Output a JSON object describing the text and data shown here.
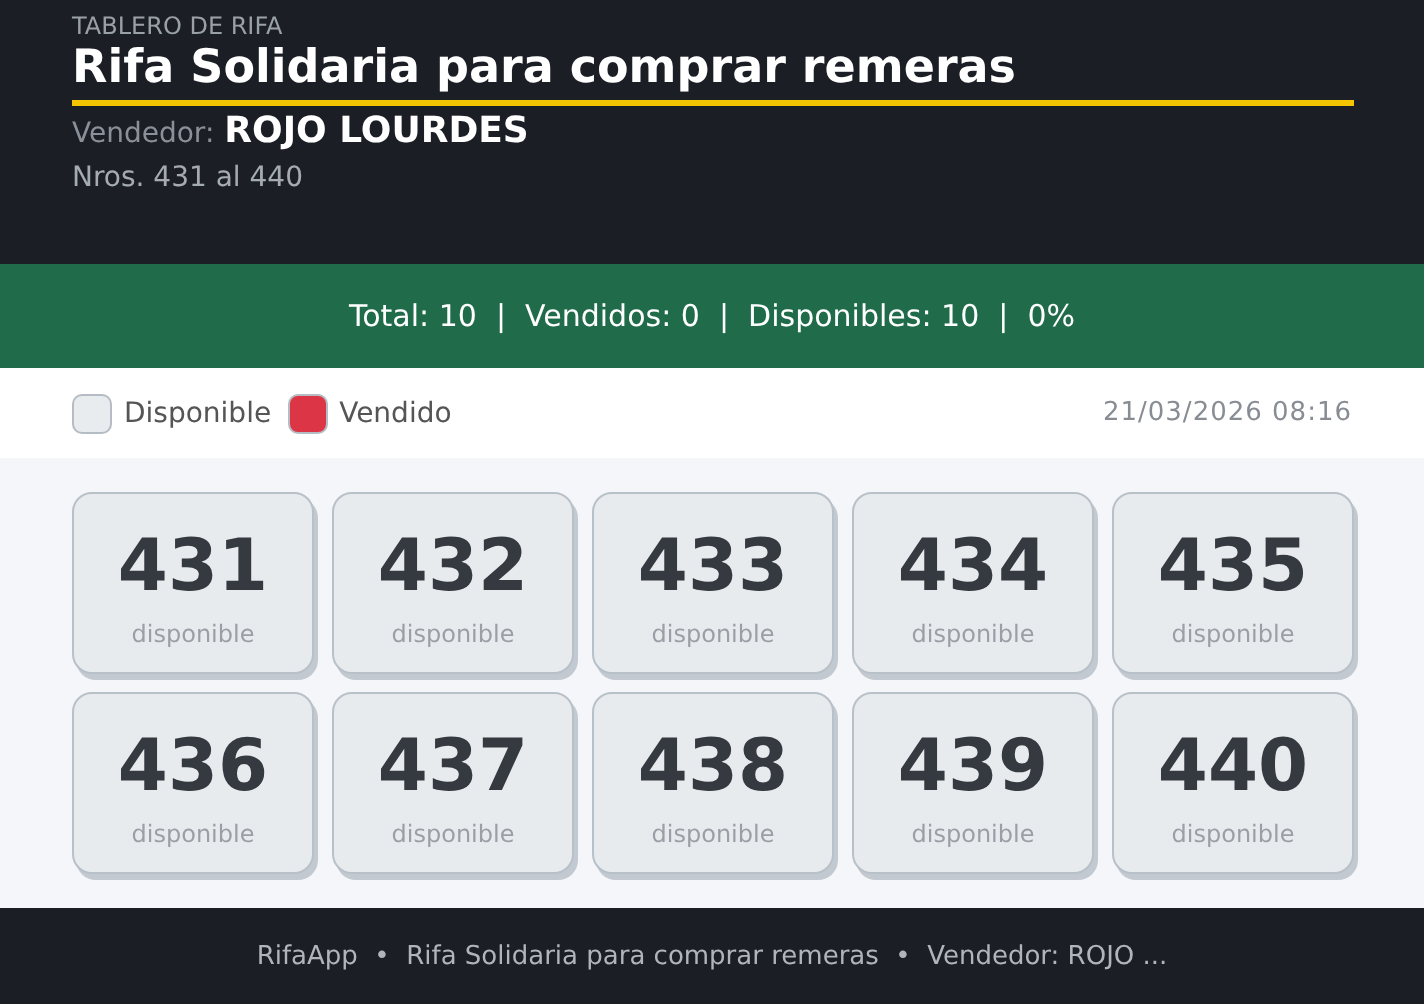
{
  "header": {
    "eyebrow": "TABLERO DE RIFA",
    "title": "Rifa Solidaria para comprar remeras",
    "seller_label": "Vendedor:",
    "seller_name": "ROJO LOURDES",
    "range": "Nros. 431 al 440"
  },
  "stats": "Total: 10  |  Vendidos: 0  |  Disponibles: 10  |  0%",
  "legend": [
    {
      "label": "Disponible",
      "color": "#e9ecef"
    },
    {
      "label": "Vendido",
      "color": "#dc3545"
    }
  ],
  "timestamp": "21/03/2026 08:16",
  "tickets": [
    {
      "number": "431",
      "status": "disponible",
      "sold": false
    },
    {
      "number": "432",
      "status": "disponible",
      "sold": false
    },
    {
      "number": "433",
      "status": "disponible",
      "sold": false
    },
    {
      "number": "434",
      "status": "disponible",
      "sold": false
    },
    {
      "number": "435",
      "status": "disponible",
      "sold": false
    },
    {
      "number": "436",
      "status": "disponible",
      "sold": false
    },
    {
      "number": "437",
      "status": "disponible",
      "sold": false
    },
    {
      "number": "438",
      "status": "disponible",
      "sold": false
    },
    {
      "number": "439",
      "status": "disponible",
      "sold": false
    },
    {
      "number": "440",
      "status": "disponible",
      "sold": false
    }
  ],
  "footer": "RifaApp  •  Rifa Solidaria para comprar remeras  •  Vendedor: ROJO ..."
}
